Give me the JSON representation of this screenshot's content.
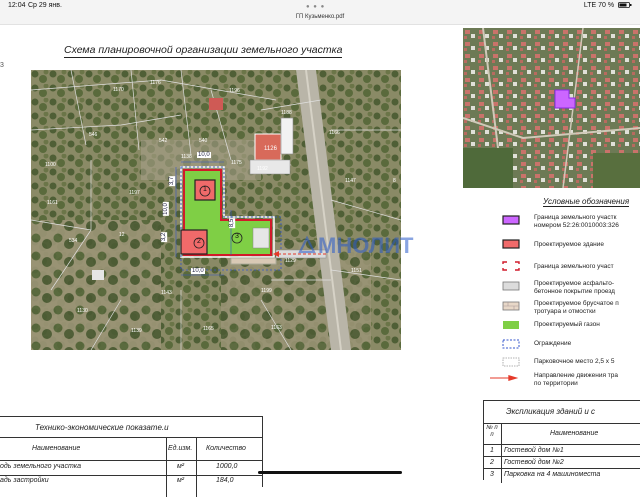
{
  "status_bar": {
    "time": "12:04",
    "date": "Ср 29 янв.",
    "network": "LTE 70 %",
    "signal_icon": "signal-icon",
    "battery_icon": "battery-icon"
  },
  "document": {
    "filename": "ГП Кузьменко.pdf",
    "scheme_title": "Схема планировочной организации земельного участка",
    "sheet_mark": "3"
  },
  "main_map": {
    "dims": {
      "top": "10,0",
      "left_upper": "3,7",
      "left_mid": "10,0",
      "left_lower": "3,2",
      "right_mid": "8,5",
      "bottom": "10,0"
    },
    "buildings": [
      {
        "label": "1",
        "color": "#f06a6a"
      },
      {
        "label": "2",
        "color": "#f06a6a"
      }
    ],
    "parking_label": "3",
    "neighbor_labels": [
      "1170",
      "1176",
      "1196",
      "546",
      "540",
      "1100",
      "1138",
      "542",
      "1197",
      "1161",
      "12",
      "534",
      "1192",
      "1188",
      "1126",
      "1147",
      "8",
      "1129",
      "1151",
      "1199",
      "1163",
      "1165",
      "1143",
      "1130",
      "1139",
      "1175",
      "1166",
      "1119",
      "1185",
      "1141"
    ],
    "parcel_color": "#7fcf45",
    "outline_color": "#d11a2a"
  },
  "watermark": {
    "text": "МНОЛИТ"
  },
  "legend": {
    "title": "Условные обозначения",
    "items": [
      {
        "text1": "Граница земельного участк",
        "text2": "номером 52:26:0010003:326",
        "icon": "boundary-purple-icon",
        "color": "#cc66ff"
      },
      {
        "text1": "Проектируемое здание",
        "text2": "",
        "icon": "building-icon",
        "color": "#f06a6a"
      },
      {
        "text1": "Граница земельного участ",
        "text2": "",
        "icon": "boundary-dash-icon",
        "color": "#d11a2a"
      },
      {
        "text1": "Проектируемое асфальто-",
        "text2": "бетонное покрытие проезд",
        "icon": "asphalt-icon",
        "color": "#dcdcdc"
      },
      {
        "text1": "Проектируемое брусчатое п",
        "text2": "тротуара и отмостки",
        "icon": "paving-icon",
        "color": "#e8d8c8"
      },
      {
        "text1": "Проектируемый газон",
        "text2": "",
        "icon": "lawn-icon",
        "color": "#7fcf45"
      },
      {
        "text1": "Ограждение",
        "text2": "",
        "icon": "fence-icon",
        "color": "#3355cc"
      },
      {
        "text1": "Парковочное место 2,5 x 5",
        "text2": "",
        "icon": "parking-icon",
        "color": "#999999"
      },
      {
        "text1": "Направление движения тра",
        "text2": "по территории",
        "icon": "traffic-arrow-icon",
        "color": "#e53a2a"
      }
    ]
  },
  "tep_table": {
    "title": "Технико-экономические показате.и",
    "headers": [
      "Наименование",
      "Ед.изм.",
      "Количество"
    ],
    "rows": [
      {
        "name": "одь земельного участка",
        "unit": "м²",
        "qty": "1000,0"
      },
      {
        "name": "адь застройки",
        "unit": "м²",
        "qty": "184,0"
      }
    ]
  },
  "explication": {
    "title": "Экспликация зданий и с",
    "headers": [
      "№ п п",
      "Наименование"
    ],
    "rows": [
      {
        "n": "1",
        "name": "Гостевой дом №1"
      },
      {
        "n": "2",
        "name": "Гостевой дом №2"
      },
      {
        "n": "3",
        "name": "Парковка на 4 машиноместа"
      }
    ]
  }
}
